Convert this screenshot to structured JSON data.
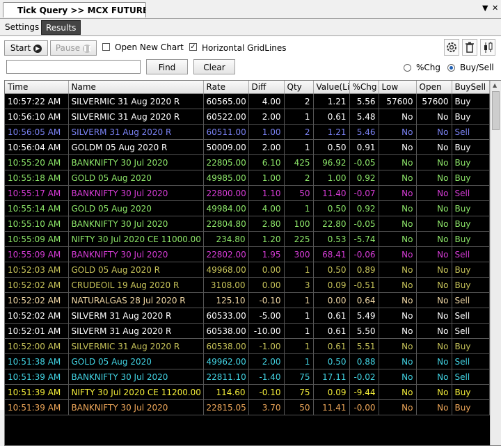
{
  "window": {
    "tab_title": "Tick Query >> MCX FUTURE R...",
    "dropdown_glyph": "▼",
    "close_glyph": "✕"
  },
  "subtabs": [
    {
      "label": "Settings"
    },
    {
      "label": "Results"
    }
  ],
  "toolbar": {
    "start_label": "Start",
    "pause_label": "Pause",
    "open_new_chart_label": "Open New Chart",
    "open_new_chart_checked": false,
    "horizontal_gridlines_label": "Horizontal GridLines",
    "horizontal_gridlines_checked": true,
    "search_value": "",
    "find_label": "Find",
    "clear_label": "Clear",
    "pct_chg_label": "%Chg",
    "buy_sell_label": "Buy/Sell",
    "selected_mode": "Buy/Sell"
  },
  "colors": {
    "green": "#8ee86a",
    "white": "#ffffff",
    "blue": "#7b83f5",
    "magenta": "#d63cd6",
    "olive": "#c8c45a",
    "beige": "#f2d9a6",
    "cyan": "#42d4e4",
    "yellow": "#f4ee3a",
    "orange": "#f0a85a"
  },
  "table": {
    "columns": [
      "Time",
      "Name",
      "Rate",
      "Diff",
      "Qty",
      "Value(Li",
      "%Chg",
      "Low",
      "Open",
      "BuySell"
    ],
    "rows": [
      [
        "10:57:22 AM",
        "SILVERMIC 31 Aug 2020 R",
        "60565.00",
        "4.00",
        "2",
        "1.21",
        "5.56",
        "57600",
        "57600",
        "Buy"
      ],
      [
        "10:56:10 AM",
        "SILVERMIC 31 Aug 2020 R",
        "60522.00",
        "2.00",
        "1",
        "0.61",
        "5.48",
        "No",
        "No",
        "Buy"
      ],
      [
        "10:56:05 AM",
        "SILVERM 31 Aug 2020 R",
        "60511.00",
        "1.00",
        "2",
        "1.21",
        "5.46",
        "No",
        "No",
        "Sell"
      ],
      [
        "10:56:04 AM",
        "GOLDM 05 Aug 2020 R",
        "50009.00",
        "2.00",
        "1",
        "0.50",
        "0.91",
        "No",
        "No",
        "Buy"
      ],
      [
        "10:55:20 AM",
        "BANKNIFTY 30 Jul 2020",
        "22805.00",
        "6.10",
        "425",
        "96.92",
        "-0.05",
        "No",
        "No",
        "Buy"
      ],
      [
        "10:55:18 AM",
        "GOLD 05 Aug 2020",
        "49985.00",
        "1.00",
        "2",
        "1.00",
        "0.92",
        "No",
        "No",
        "Buy"
      ],
      [
        "10:55:17 AM",
        "BANKNIFTY 30 Jul 2020",
        "22800.00",
        "1.10",
        "50",
        "11.40",
        "-0.07",
        "No",
        "No",
        "Sell"
      ],
      [
        "10:55:14 AM",
        "GOLD 05 Aug 2020",
        "49984.00",
        "4.00",
        "1",
        "0.50",
        "0.92",
        "No",
        "No",
        "Buy"
      ],
      [
        "10:55:10 AM",
        "BANKNIFTY 30 Jul 2020",
        "22804.80",
        "2.80",
        "100",
        "22.80",
        "-0.05",
        "No",
        "No",
        "Buy"
      ],
      [
        "10:55:09 AM",
        "NIFTY 30 Jul 2020 CE 11000.00",
        "234.80",
        "1.20",
        "225",
        "0.53",
        "-5.74",
        "No",
        "No",
        "Buy"
      ],
      [
        "10:55:09 AM",
        "BANKNIFTY 30 Jul 2020",
        "22802.00",
        "1.95",
        "300",
        "68.41",
        "-0.06",
        "No",
        "No",
        "Sell"
      ],
      [
        "10:52:03 AM",
        "GOLD 05 Aug 2020 R",
        "49968.00",
        "0.00",
        "1",
        "0.50",
        "0.89",
        "No",
        "No",
        "Buy"
      ],
      [
        "10:52:02 AM",
        "CRUDEOIL 19 Aug 2020 R",
        "3108.00",
        "0.00",
        "3",
        "0.09",
        "-0.51",
        "No",
        "No",
        "Buy"
      ],
      [
        "10:52:02 AM",
        "NATURALGAS 28 Jul 2020 R",
        "125.10",
        "-0.10",
        "1",
        "0.00",
        "0.64",
        "No",
        "No",
        "Sell"
      ],
      [
        "10:52:02 AM",
        "SILVERM 31 Aug 2020 R",
        "60533.00",
        "-5.00",
        "1",
        "0.61",
        "5.49",
        "No",
        "No",
        "Sell"
      ],
      [
        "10:52:01 AM",
        "SILVERM 31 Aug 2020 R",
        "60538.00",
        "-10.00",
        "1",
        "0.61",
        "5.50",
        "No",
        "No",
        "Sell"
      ],
      [
        "10:52:00 AM",
        "SILVERMIC 31 Aug 2020 R",
        "60538.00",
        "-1.00",
        "1",
        "0.61",
        "5.51",
        "No",
        "No",
        "Buy"
      ],
      [
        "10:51:38 AM",
        "GOLD 05 Aug 2020",
        "49962.00",
        "2.00",
        "1",
        "0.50",
        "0.88",
        "No",
        "No",
        "Sell"
      ],
      [
        "10:51:39 AM",
        "BANKNIFTY 30 Jul 2020",
        "22811.10",
        "-1.40",
        "75",
        "17.11",
        "-0.02",
        "No",
        "No",
        "Sell"
      ],
      [
        "10:51:39 AM",
        "NIFTY 30 Jul 2020 CE 11200.00",
        "114.60",
        "-0.10",
        "75",
        "0.09",
        "-9.44",
        "No",
        "No",
        "Buy"
      ],
      [
        "10:51:39 AM",
        "BANKNIFTY 30 Jul 2020",
        "22815.05",
        "3.70",
        "50",
        "11.41",
        "-0.00",
        "No",
        "No",
        "Buy"
      ]
    ],
    "row_colors": [
      "white",
      "white",
      "blue",
      "white",
      "green",
      "green",
      "magenta",
      "green",
      "green",
      "green",
      "magenta",
      "olive",
      "olive",
      "beige",
      "white",
      "white",
      "olive",
      "cyan",
      "cyan",
      "yellow",
      "orange"
    ]
  }
}
